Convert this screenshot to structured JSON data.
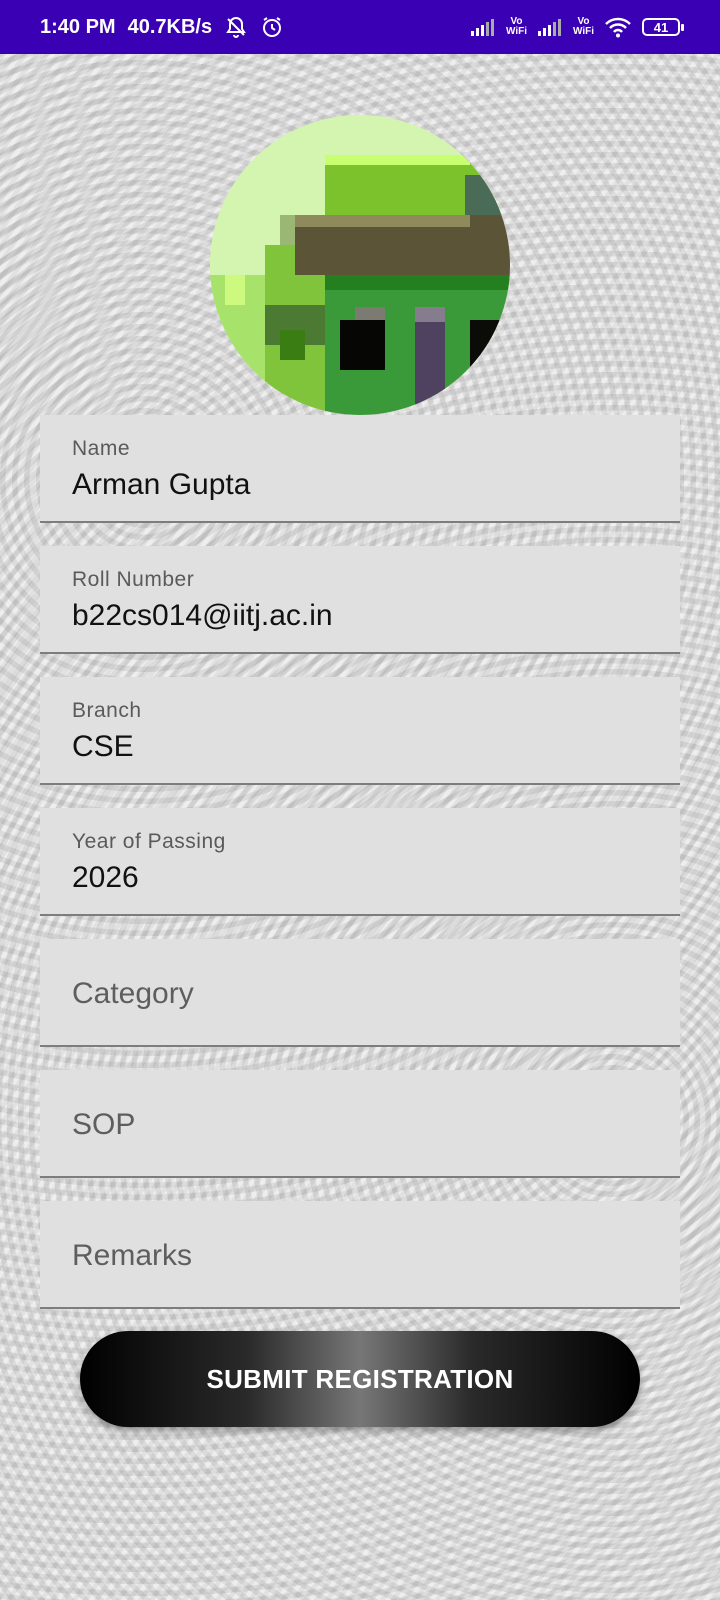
{
  "status_bar": {
    "time": "1:40 PM",
    "speed": "40.7KB/s",
    "vowifi_1": [
      "Vo",
      "WiFi"
    ],
    "vowifi_2": [
      "Vo",
      "WiFi"
    ],
    "battery": "41",
    "background": "#3a00b4"
  },
  "avatar": {
    "icon": "profile-picture"
  },
  "form": {
    "name": {
      "label": "Name",
      "value": "Arman Gupta"
    },
    "roll": {
      "label": "Roll Number",
      "value": "b22cs014@iitj.ac.in"
    },
    "branch": {
      "label": "Branch",
      "value": "CSE"
    },
    "year": {
      "label": "Year of Passing",
      "value": "2026"
    },
    "category": {
      "placeholder": "Category"
    },
    "sop": {
      "placeholder": "SOP"
    },
    "remarks": {
      "placeholder": "Remarks"
    }
  },
  "submit_label": "SUBMIT REGISTRATION"
}
